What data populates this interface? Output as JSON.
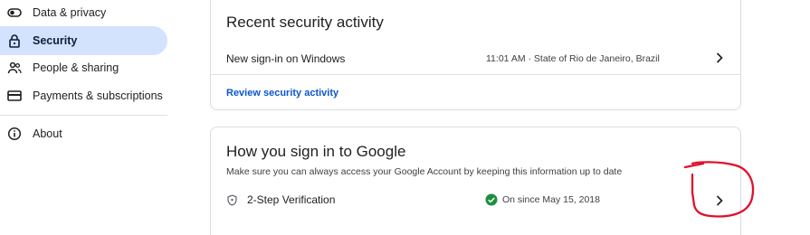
{
  "sidebar": {
    "items": [
      {
        "label": "Data & privacy",
        "icon": "toggle-icon"
      },
      {
        "label": "Security",
        "icon": "lock-icon",
        "active": true
      },
      {
        "label": "People & sharing",
        "icon": "people-icon"
      },
      {
        "label": "Payments & subscriptions",
        "icon": "credit-card-icon"
      },
      {
        "label": "About",
        "icon": "info-icon"
      }
    ]
  },
  "recent_activity": {
    "title": "Recent security activity",
    "event": "New sign-in on Windows",
    "event_detail": "11:01 AM · State of Rio de Janeiro, Brazil",
    "review_link": "Review security activity"
  },
  "sign_in": {
    "title": "How you sign in to Google",
    "subtitle": "Make sure you can always access your Google Account by keeping this information up to date",
    "two_step_label": "2-Step Verification",
    "two_step_status": "On since May 15, 2018"
  },
  "colors": {
    "accent": "#0b57d0",
    "active_bg": "#d3e3fd",
    "success": "#1e8e3e",
    "annotation": "#e0112b"
  }
}
